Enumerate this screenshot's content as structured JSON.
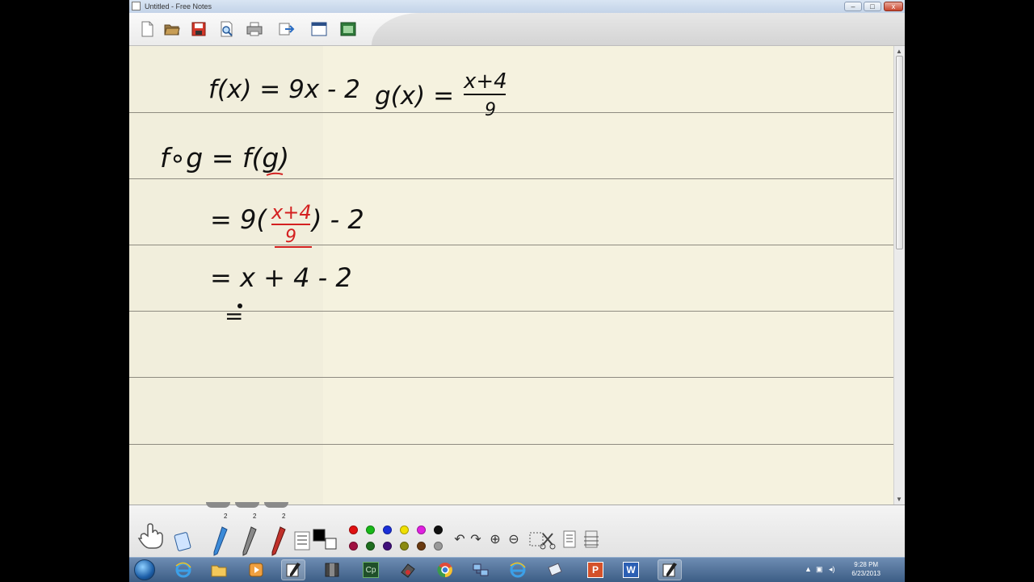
{
  "window": {
    "title": "Untitled - Free Notes",
    "minimize_glyph": "–",
    "maximize_glyph": "□",
    "close_glyph": "x"
  },
  "toolbar": {
    "buttons": [
      {
        "name": "new-document",
        "icon": "new-document-icon"
      },
      {
        "name": "open",
        "icon": "folder-open-icon"
      },
      {
        "name": "save",
        "icon": "save-disk-icon"
      },
      {
        "name": "print-preview",
        "icon": "print-preview-icon"
      },
      {
        "name": "print",
        "icon": "printer-icon"
      },
      {
        "name": "export",
        "icon": "export-icon"
      },
      {
        "name": "window",
        "icon": "window-icon"
      },
      {
        "name": "screen-capture",
        "icon": "screen-capture-icon"
      }
    ]
  },
  "notes": {
    "line1_f": "f(x) = 9x - 2",
    "line1_g": "g(x) =",
    "g_numerator": "x+4",
    "g_denominator": "9",
    "line2": "f∘g = f(g)",
    "line3_prefix": "= 9(",
    "line3_num": "x+4",
    "line3_den": "9",
    "line3_suffix": ") - 2",
    "line4": "= x + 4 - 2",
    "line5": "="
  },
  "pens": {
    "sizes": [
      "2",
      "2",
      "2"
    ]
  },
  "palette": {
    "row1": [
      "#e01010",
      "#18b818",
      "#1a2fd8",
      "#f0e000",
      "#e020e0",
      "#111111"
    ],
    "row2": [
      "#a01040",
      "#1e6e1e",
      "#40107a",
      "#8a8a10",
      "#6a3a10",
      "#999999"
    ],
    "black": "#000000",
    "white": "#ffffff"
  },
  "taskbar": {
    "apps": [
      "internet-explorer",
      "file-explorer",
      "media-player",
      "free-notes",
      "archive",
      "captivate",
      "tool",
      "chrome",
      "network",
      "internet-explorer-2",
      "notepad",
      "powerpoint",
      "word",
      "free-notes-2"
    ],
    "captivate_label": "Cp",
    "powerpoint_label": "P",
    "word_label": "W",
    "time": "9:28 PM",
    "date": "6/23/2013"
  }
}
